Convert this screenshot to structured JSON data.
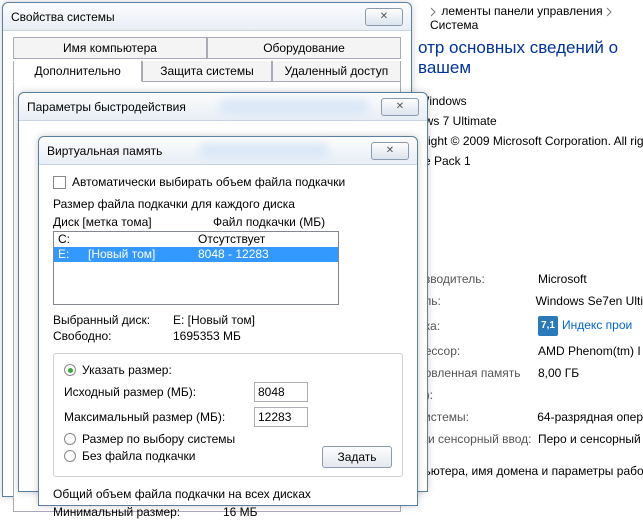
{
  "bg": {
    "breadcrumb1": "лементы панели управления",
    "breadcrumb2": "Система",
    "heading": "отр основных сведений о вашем",
    "line1": "Windows",
    "line2": "ows 7 Ultimate",
    "line3": "yright © 2009 Microsoft Corporation.  All rig",
    "line4": "ce Pack 1",
    "rows": {
      "maker_l": "изводитель:",
      "maker_v": "Microsoft",
      "model_l": "ель:",
      "model_v": "Windows Se7en Ulti",
      "rating_l": "нка:",
      "rating_badge": "7,1",
      "rating_v": "Индекс прои",
      "cpu_l": "цессор:",
      "cpu_v": "AMD Phenom(tm) I",
      "ram_l": "новленная память",
      "ram_v": "8,00 ГБ",
      "ramhint": "У):",
      "arch_l": "системы:",
      "arch_v": "64-разрядная опер",
      "pen_l": "о и сенсорный ввод:",
      "pen_v": "Перо и сенсорный"
    },
    "footer": "пьютера, имя домена и параметры рабо"
  },
  "sysprop": {
    "title": "Свойства системы",
    "tabs1": {
      "a": "Имя компьютера",
      "b": "Оборудование"
    },
    "tabs2": {
      "a": "Дополнительно",
      "b": "Защита системы",
      "c": "Удаленный доступ"
    }
  },
  "perf": {
    "title": "Параметры быстродействия"
  },
  "vmem": {
    "title": "Виртуальная память",
    "auto": "Автоматически выбирать объем файла подкачки",
    "each": "Размер файла подкачки для каждого диска",
    "hdr_disk": "Диск [метка тома]",
    "hdr_file": "Файл подкачки (МБ)",
    "rows": [
      {
        "d": "C:",
        "vol": "",
        "pf": "Отсутствует",
        "sel": false
      },
      {
        "d": "E:",
        "vol": "[Новый том]",
        "pf": "8048 - 12283",
        "sel": true
      }
    ],
    "seldisk_l": "Выбранный диск:",
    "seldisk_v": "E:   [Новый том]",
    "free_l": "Свободно:",
    "free_v": "1695353 МБ",
    "opt_custom": "Указать размер:",
    "init_l": "Исходный размер (МБ):",
    "init_v": "8048",
    "max_l": "Максимальный размер (МБ):",
    "max_v": "12283",
    "opt_sys": "Размер по выбору системы",
    "opt_none": "Без файла подкачки",
    "set_btn": "Задать",
    "total_hdr": "Общий объем файла подкачки на всех дисках",
    "min_l": "Минимальный размер:",
    "min_v": "16 МБ"
  }
}
